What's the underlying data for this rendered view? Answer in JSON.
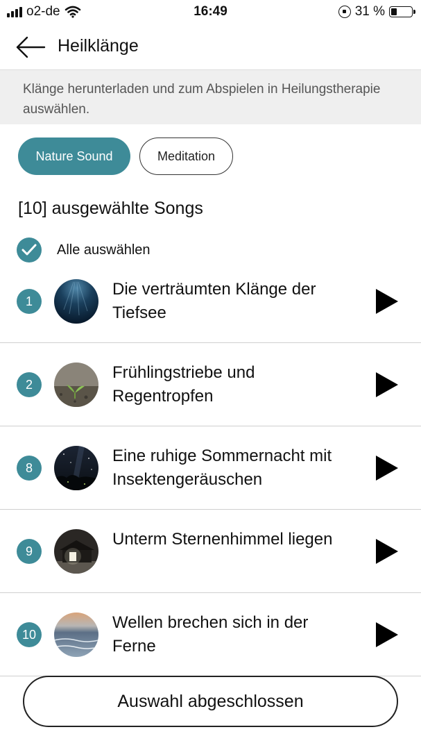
{
  "status_bar": {
    "carrier": "o2-de",
    "time": "16:49",
    "battery": "31 %",
    "battery_level": 0.31
  },
  "header": {
    "title": "Heilklänge",
    "back_icon": "arrow-left-icon"
  },
  "banner": {
    "text": "Klänge herunterladen und zum Abspielen in Heilungstherapie auswählen."
  },
  "chips": [
    {
      "label": "Nature Sound",
      "active": true
    },
    {
      "label": "Meditation",
      "active": false
    }
  ],
  "selected_count": "[10] ausgewählte Songs",
  "select_all": {
    "label": "Alle auswählen",
    "checked": true
  },
  "songs": [
    {
      "number": "1",
      "title": "Die verträumten Klänge der Tiefsee",
      "thumb": "deep-sea-thumbnail"
    },
    {
      "number": "2",
      "title": "Frühlingstriebe und Regentropfen",
      "thumb": "sprout-thumbnail"
    },
    {
      "number": "8",
      "title": "Eine ruhige Sommernacht mit Insektengeräuschen",
      "thumb": "night-sky-thumbnail"
    },
    {
      "number": "9",
      "title": "Unterm Sternenhimmel liegen",
      "thumb": "cabin-night-thumbnail"
    },
    {
      "number": "10",
      "title": "Wellen brechen sich in der Ferne",
      "thumb": "ocean-waves-thumbnail"
    }
  ],
  "finish_button": {
    "label": "Auswahl abgeschlossen"
  },
  "colors": {
    "accent": "#3e8b98",
    "banner_bg": "#efefef",
    "divider": "#cfcfcf"
  }
}
